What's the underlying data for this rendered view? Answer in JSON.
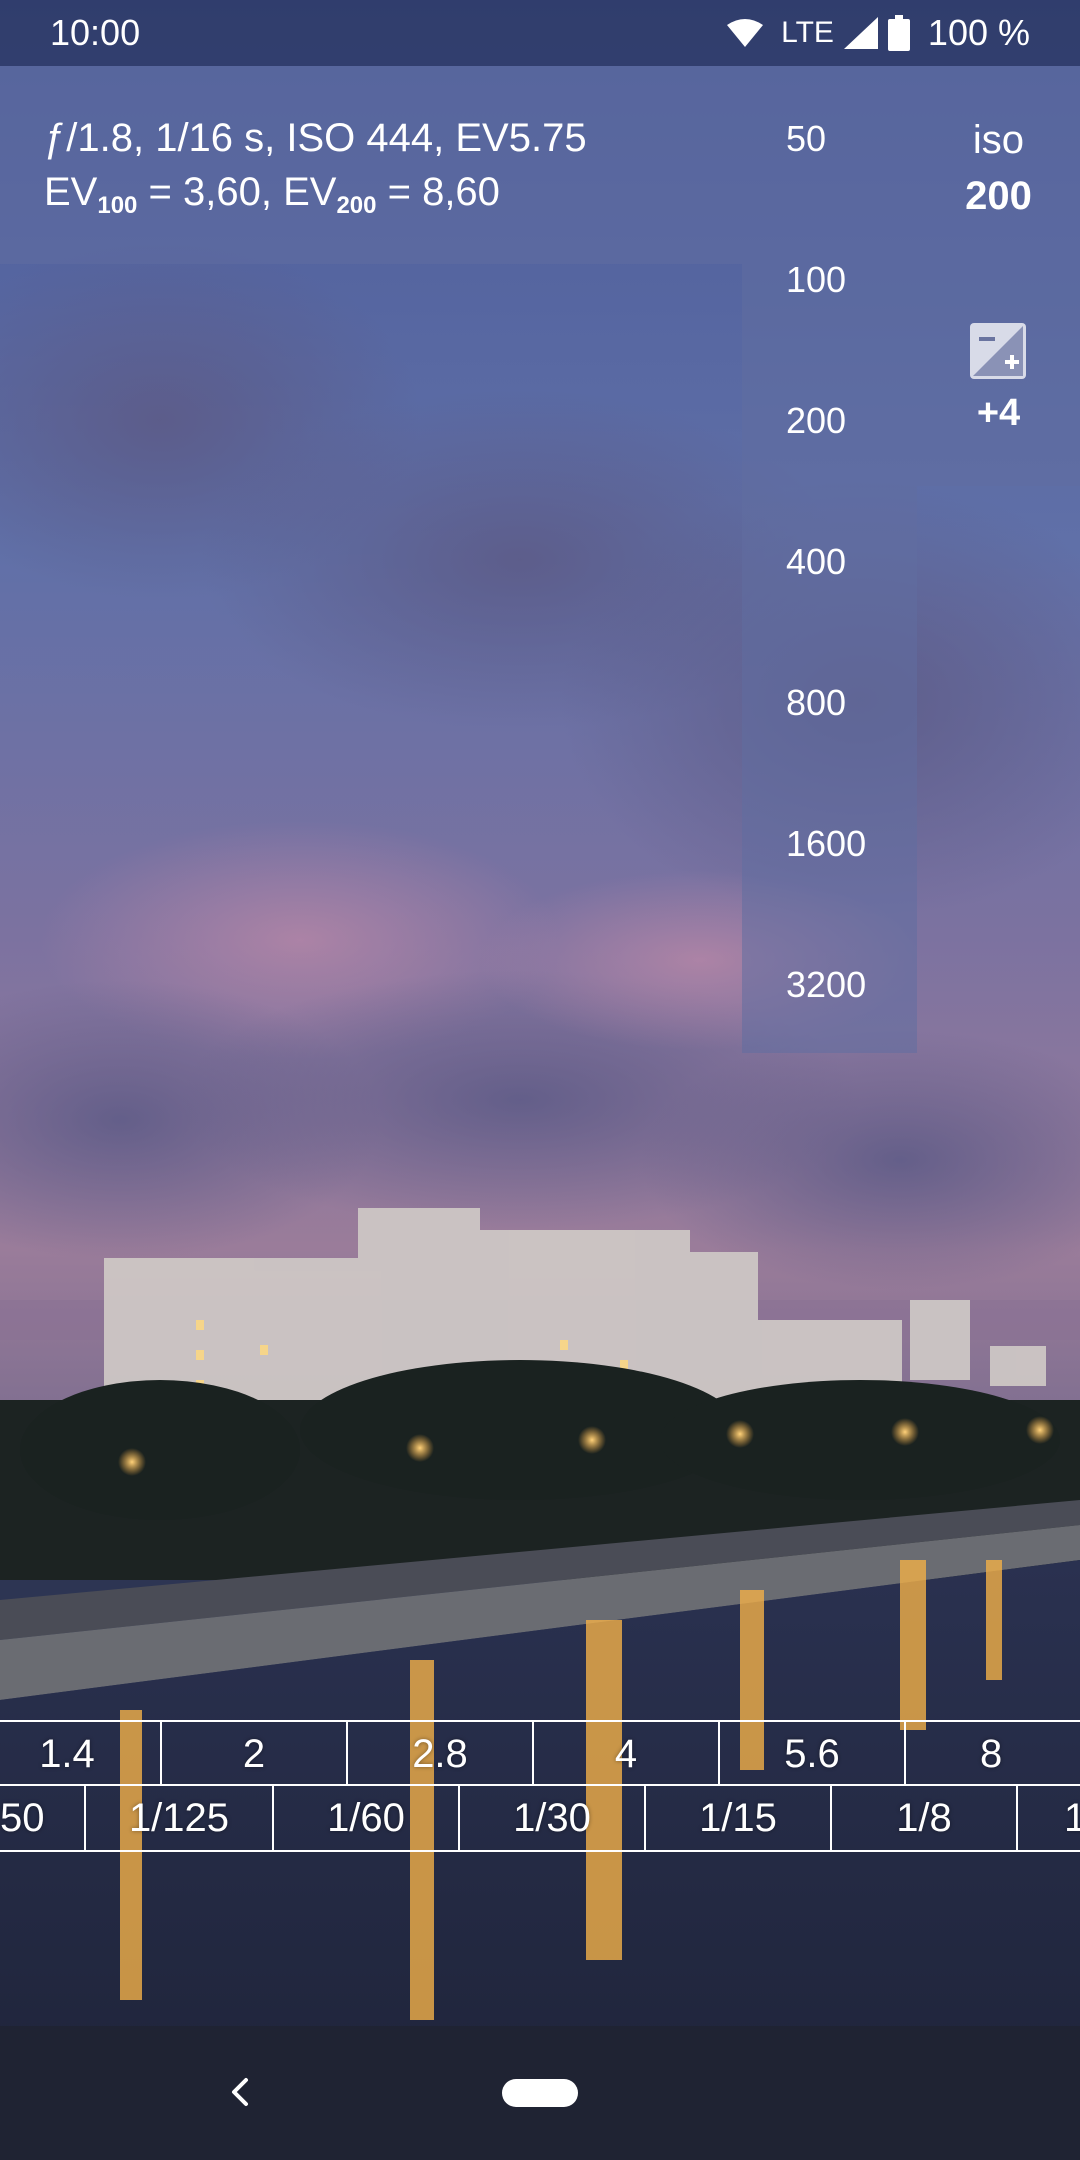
{
  "status_bar": {
    "time": "10:00",
    "network": "LTE",
    "battery": "100 %",
    "icons": [
      "wifi-icon",
      "signal-icon",
      "battery-icon"
    ]
  },
  "readout": {
    "line1": "ƒ/1.8, 1/16 s, ISO 444, EV5.75",
    "ev_label": "EV",
    "ev100_sub": "100",
    "ev100_value": " = 3,60, ",
    "ev200_sub": "200",
    "ev200_value": " = 8,60"
  },
  "iso_scale": [
    "50",
    "100",
    "200",
    "400",
    "800",
    "1600",
    "3200"
  ],
  "iso_control": {
    "label": "iso",
    "value": "200"
  },
  "ev_compensation": {
    "icon": "exposure-compensation-icon",
    "value": "+4"
  },
  "aperture_scale": [
    "1.4",
    "2",
    "2.8",
    "4",
    "5.6",
    "8"
  ],
  "shutter_scale": [
    "50",
    "1/125",
    "1/60",
    "1/30",
    "1/15",
    "1/8",
    "1"
  ],
  "colors": {
    "panel": "#606ea0",
    "status_bar": "#28345f",
    "nav_bar": "#1f2333",
    "text": "#ffffff"
  },
  "nav_bar": {
    "icons": [
      "back-icon",
      "home-pill-icon"
    ]
  }
}
